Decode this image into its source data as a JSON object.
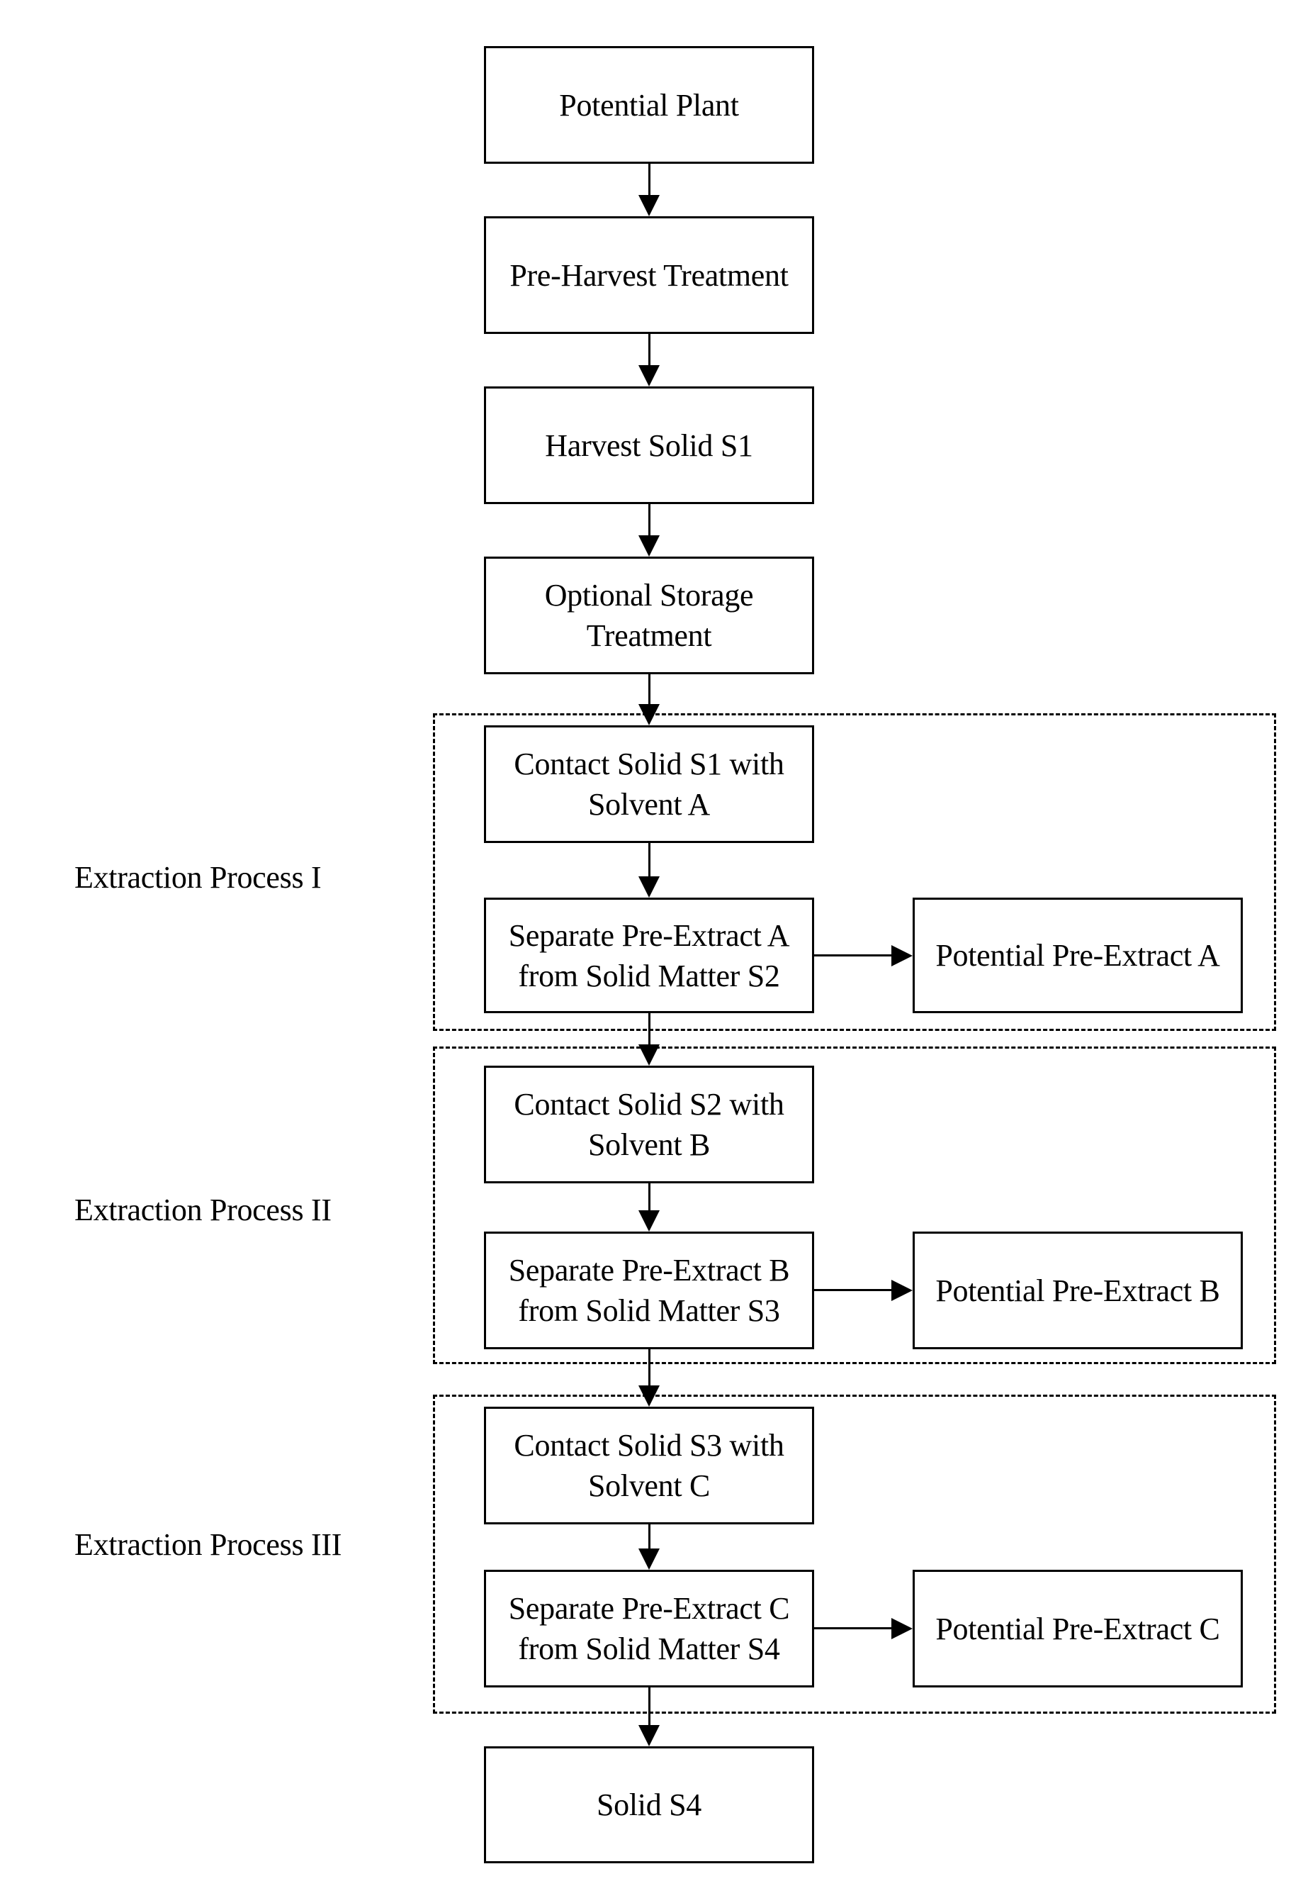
{
  "diagram": {
    "main_flow": [
      {
        "id": "potential-plant",
        "text": "Potential Plant"
      },
      {
        "id": "pre-harvest-treatment",
        "text": "Pre-Harvest Treatment"
      },
      {
        "id": "harvest-solid-s1",
        "text": "Harvest Solid S1"
      },
      {
        "id": "optional-storage-treatment",
        "text": "Optional Storage\nTreatment"
      }
    ],
    "processes": [
      {
        "label": "Extraction Process I",
        "contact": "Contact Solid S1 with\nSolvent A",
        "separate": "Separate Pre-Extract A\nfrom Solid Matter S2",
        "output": "Potential Pre-Extract A"
      },
      {
        "label": "Extraction Process II",
        "contact": "Contact Solid S2 with\nSolvent B",
        "separate": "Separate Pre-Extract B\nfrom Solid Matter S3",
        "output": "Potential Pre-Extract B"
      },
      {
        "label": "Extraction Process III",
        "contact": "Contact Solid S3 with\nSolvent C",
        "separate": "Separate Pre-Extract C\nfrom Solid Matter S4",
        "output": "Potential Pre-Extract C"
      }
    ],
    "final": {
      "id": "solid-s4",
      "text": "Solid S4"
    },
    "edges": [
      {
        "from": "Potential Plant",
        "to": "Pre-Harvest Treatment"
      },
      {
        "from": "Pre-Harvest Treatment",
        "to": "Harvest Solid S1"
      },
      {
        "from": "Harvest Solid S1",
        "to": "Optional Storage Treatment"
      },
      {
        "from": "Optional Storage Treatment",
        "to": "Contact Solid S1 with Solvent A"
      },
      {
        "from": "Contact Solid S1 with Solvent A",
        "to": "Separate Pre-Extract A from Solid Matter S2"
      },
      {
        "from": "Separate Pre-Extract A from Solid Matter S2",
        "to": "Potential Pre-Extract A"
      },
      {
        "from": "Separate Pre-Extract A from Solid Matter S2",
        "to": "Contact Solid S2 with Solvent B"
      },
      {
        "from": "Contact Solid S2 with Solvent B",
        "to": "Separate Pre-Extract B from Solid Matter S3"
      },
      {
        "from": "Separate Pre-Extract B from Solid Matter S3",
        "to": "Potential Pre-Extract B"
      },
      {
        "from": "Separate Pre-Extract B from Solid Matter S3",
        "to": "Contact Solid S3 with Solvent C"
      },
      {
        "from": "Contact Solid S3 with Solvent C",
        "to": "Separate Pre-Extract C from Solid Matter S4"
      },
      {
        "from": "Separate Pre-Extract C from Solid Matter S4",
        "to": "Potential Pre-Extract C"
      },
      {
        "from": "Separate Pre-Extract C from Solid Matter S4",
        "to": "Solid S4"
      }
    ],
    "colors": {
      "line": "#000000",
      "background": "#ffffff"
    }
  }
}
